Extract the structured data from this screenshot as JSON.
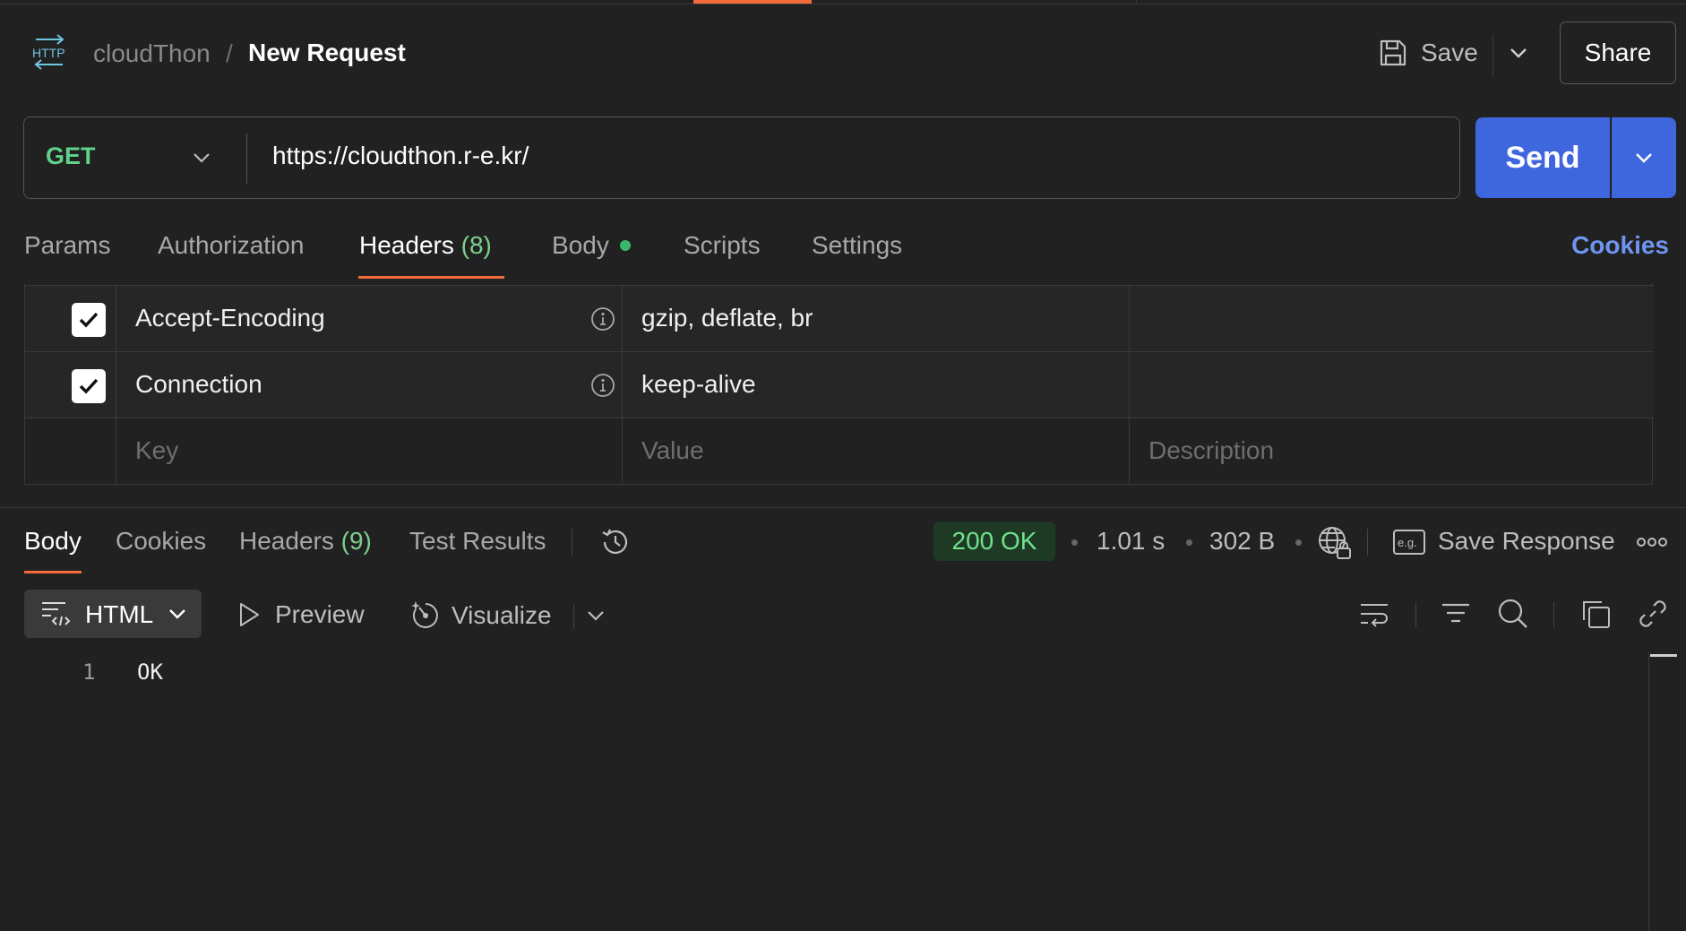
{
  "header": {
    "protocol_icon": "http-icon",
    "workspace": "cloudThon",
    "separator": "/",
    "request_title": "New Request",
    "save_label": "Save",
    "share_label": "Share"
  },
  "request": {
    "method": "GET",
    "url": "https://cloudthon.r-e.kr/",
    "send_label": "Send"
  },
  "request_tabs": {
    "params": "Params",
    "authorization": "Authorization",
    "headers": "Headers",
    "headers_count": "(8)",
    "body": "Body",
    "scripts": "Scripts",
    "settings": "Settings",
    "cookies": "Cookies"
  },
  "headers_table": {
    "rows": [
      {
        "checked": true,
        "key": "Accept-Encoding",
        "value": "gzip, deflate, br"
      },
      {
        "checked": true,
        "key": "Connection",
        "value": "keep-alive"
      }
    ],
    "placeholders": {
      "key": "Key",
      "value": "Value",
      "description": "Description"
    }
  },
  "response_tabs": {
    "body": "Body",
    "cookies": "Cookies",
    "headers": "Headers",
    "headers_count": "(9)",
    "test_results": "Test Results"
  },
  "response_meta": {
    "status": "200 OK",
    "time": "1.01 s",
    "size": "302 B",
    "save_response": "Save Response"
  },
  "response_toolbar": {
    "format": "HTML",
    "preview": "Preview",
    "visualize": "Visualize"
  },
  "response_body": {
    "lines": [
      {
        "number": "1",
        "text": "OK"
      }
    ]
  },
  "colors": {
    "background": "#212121",
    "accent_orange": "#f26b3a",
    "send_blue": "#3f67dd",
    "method_green": "#5fd18a",
    "status_green": "#6ee28c",
    "link_blue": "#6f95f2"
  }
}
